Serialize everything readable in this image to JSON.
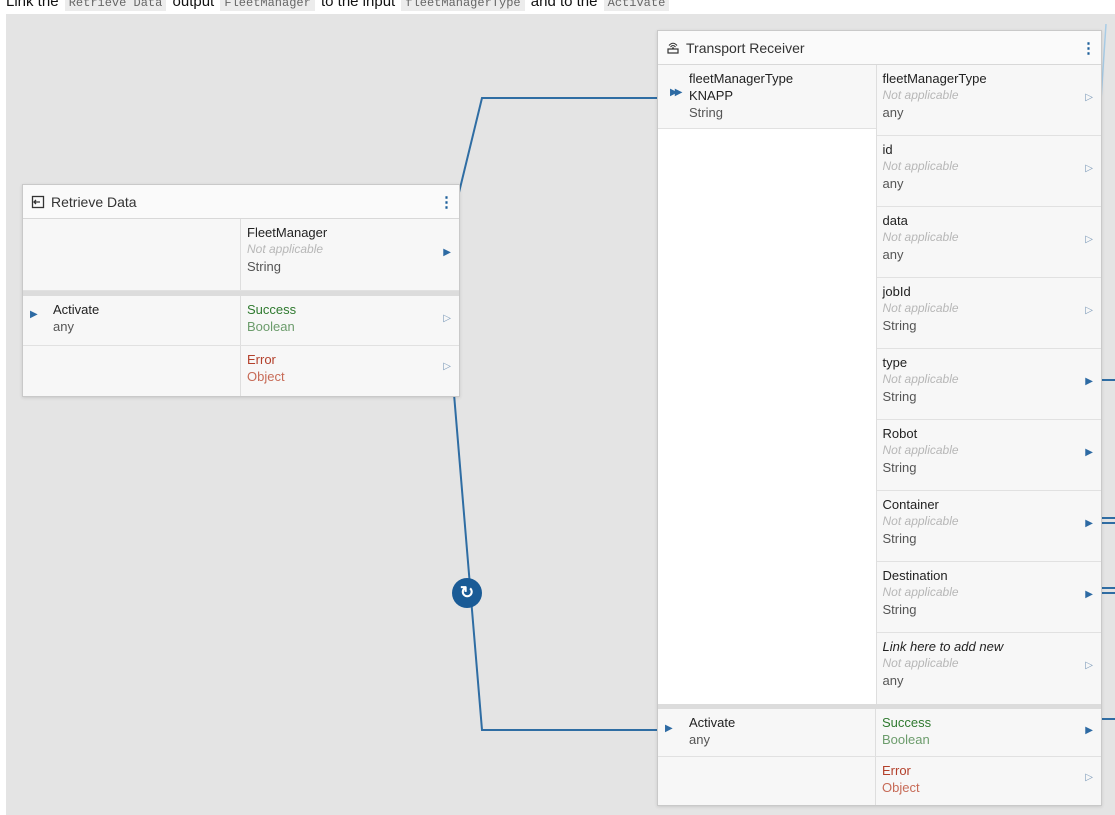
{
  "instruction": {
    "p1": "Link the ",
    "c1": "Retrieve Data",
    "p2": " output ",
    "c2": "FleetManager",
    "p3": " to the input ",
    "c3": "fleetManagerType",
    "p4": " and to the ",
    "c4": "Activate"
  },
  "retrieve": {
    "title": "Retrieve Data",
    "icon": "exit-arrow-icon",
    "output": {
      "name": "FleetManager",
      "note": "Not applicable",
      "type": "String"
    },
    "activate": {
      "name": "Activate",
      "type": "any"
    },
    "success": {
      "name": "Success",
      "type": "Boolean"
    },
    "error": {
      "name": "Error",
      "type": "Object"
    }
  },
  "transport": {
    "title": "Transport Receiver",
    "icon": "antenna-icon",
    "input": {
      "name": "fleetManagerType",
      "value": "KNAPP",
      "type": "String"
    },
    "outputs": [
      {
        "name": "fleetManagerType",
        "note": "Not applicable",
        "type": "any"
      },
      {
        "name": "id",
        "note": "Not applicable",
        "type": "any"
      },
      {
        "name": "data",
        "note": "Not applicable",
        "type": "any"
      },
      {
        "name": "jobId",
        "note": "Not applicable",
        "type": "String"
      },
      {
        "name": "type",
        "note": "Not applicable",
        "type": "String"
      },
      {
        "name": "Robot",
        "note": "Not applicable",
        "type": "String"
      },
      {
        "name": "Container",
        "note": "Not applicable",
        "type": "String"
      },
      {
        "name": "Destination",
        "note": "Not applicable",
        "type": "String"
      },
      {
        "name": "Link here to add new",
        "note": "Not applicable",
        "type": "any"
      }
    ],
    "activate": {
      "name": "Activate",
      "type": "any"
    },
    "success": {
      "name": "Success",
      "type": "Boolean"
    },
    "error": {
      "name": "Error",
      "type": "Object"
    }
  },
  "colors": {
    "wire": "#2f6da3",
    "accent": "#1a5b96",
    "canvas": "#e4e4e4"
  },
  "badge_icon": "refresh-icon"
}
